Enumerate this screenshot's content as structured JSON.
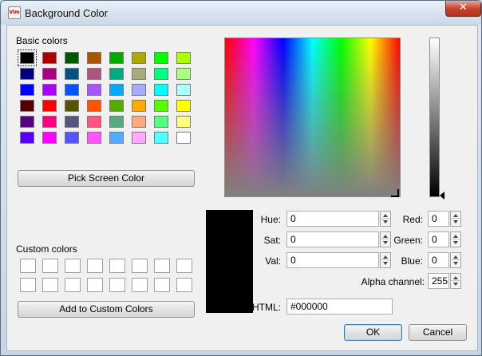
{
  "window": {
    "title": "Background Color",
    "app_icon_text": "Vlm",
    "close_glyph": "✕"
  },
  "basic_colors": {
    "label": "Basic colors",
    "rows": [
      [
        "#000000",
        "#aa0000",
        "#005500",
        "#aa5500",
        "#00aa00",
        "#aaaa00",
        "#00ff00",
        "#aaff00"
      ],
      [
        "#00007f",
        "#aa007f",
        "#00557f",
        "#aa557f",
        "#00aa7f",
        "#aaaa7f",
        "#00ff7f",
        "#aaff7f"
      ],
      [
        "#0000ff",
        "#aa00ff",
        "#0055ff",
        "#aa55ff",
        "#00aaff",
        "#aaaaff",
        "#00ffff",
        "#aaffff"
      ],
      [
        "#550000",
        "#ff0000",
        "#555500",
        "#ff5500",
        "#55aa00",
        "#ffaa00",
        "#55ff00",
        "#ffff00"
      ],
      [
        "#55007f",
        "#ff007f",
        "#55557f",
        "#ff557f",
        "#55aa7f",
        "#ffaa7f",
        "#55ff7f",
        "#ffff7f"
      ],
      [
        "#5500ff",
        "#ff00ff",
        "#5555ff",
        "#ff55ff",
        "#55aaff",
        "#ffaaff",
        "#55ffff",
        "#ffffff"
      ]
    ],
    "selected": "#000000"
  },
  "pick_screen_color_label": "Pick Screen Color",
  "custom_colors": {
    "label": "Custom colors"
  },
  "add_custom_label": "Add to Custom Colors",
  "fields": {
    "hue": {
      "label": "Hue:",
      "value": "0"
    },
    "sat": {
      "label": "Sat:",
      "value": "0"
    },
    "val": {
      "label": "Val:",
      "value": "0"
    },
    "red": {
      "label": "Red:",
      "value": "0"
    },
    "green": {
      "label": "Green:",
      "value": "0"
    },
    "blue": {
      "label": "Blue:",
      "value": "0"
    },
    "alpha": {
      "label": "Alpha channel:",
      "value": "255"
    },
    "html": {
      "label": "HTML:",
      "value": "#000000"
    }
  },
  "current_color": "#000000",
  "buttons": {
    "ok": "OK",
    "cancel": "Cancel"
  }
}
